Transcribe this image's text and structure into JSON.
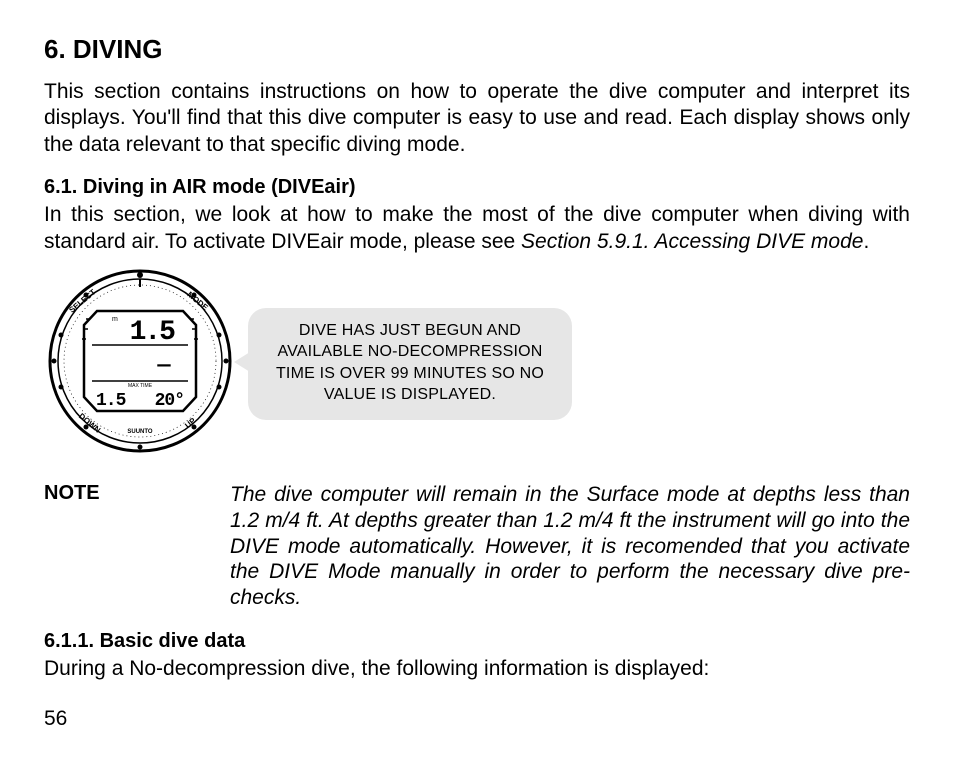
{
  "heading": "6. DIVING",
  "intro": "This section contains instructions on how to operate the dive computer and interpret its displays. You'll find that this dive computer is easy to use and read. Each display shows only the data relevant to that specific diving mode.",
  "section61_title": "6.1. Diving in AIR mode (DIVEair)",
  "section61_body_a": "In this section, we look at how to make the most of the dive computer when diving with standard air. To activate DIVEair mode, please see ",
  "section61_body_ref": "Section 5.9.1. Accessing DIVE mode",
  "section61_body_b": ".",
  "watch": {
    "label_tl": "SELECT",
    "label_tr": "MODE",
    "label_bl": "DOWN",
    "label_br": "UP",
    "brand": "SUUNTO",
    "depth_unit": "m",
    "depth_value": "1.5",
    "center_row": "―",
    "bottom_left": "1.5",
    "bottom_right": "20°"
  },
  "callout_l1": "DIVE HAS JUST BEGUN AND",
  "callout_l2": "AVAILABLE NO-DECOMPRESSION",
  "callout_l3": "TIME IS OVER 99 MINUTES SO NO",
  "callout_l4": "VALUE IS DISPLAYED.",
  "note_label": "NOTE",
  "note_body": "The dive computer will remain in the Surface mode at depths less than 1.2 m/4 ft. At depths greater than 1.2 m/4 ft the instrument will go into the DIVE mode automatically. However, it is recomended that you activate the DIVE Mode manually in order to perform the necessary dive pre-checks.",
  "section611_title": "6.1.1. Basic dive data",
  "section611_body": "During a No-decompression dive, the following information is displayed:",
  "page_number": "56"
}
